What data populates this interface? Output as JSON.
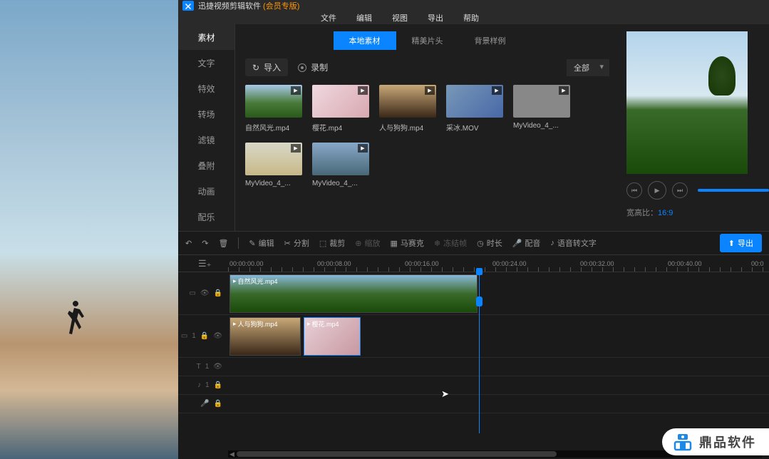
{
  "titlebar": {
    "app_name": "迅捷视频剪辑软件",
    "suffix": " (会员专版)"
  },
  "menubar": [
    "文件",
    "编辑",
    "视图",
    "导出",
    "帮助"
  ],
  "sidebar": {
    "items": [
      "素材",
      "文字",
      "特效",
      "转场",
      "滤镜",
      "叠附",
      "动画",
      "配乐"
    ],
    "active_index": 0
  },
  "media_tabs": {
    "items": [
      "本地素材",
      "精美片头",
      "背景样例"
    ],
    "active_index": 0
  },
  "media_toolbar": {
    "import_label": "导入",
    "record_label": "录制",
    "dropdown_label": "全部"
  },
  "media_items": [
    {
      "name": "自然风光.mp4",
      "thumb_class": "th-nature"
    },
    {
      "name": "樱花.mp4",
      "thumb_class": "th-sakura"
    },
    {
      "name": "人与狗狗.mp4",
      "thumb_class": "th-person"
    },
    {
      "name": "采冰.MOV",
      "thumb_class": "th-ice"
    },
    {
      "name": "MyVideo_4_...",
      "thumb_class": "th-gen"
    },
    {
      "name": "MyVideo_4_...",
      "thumb_class": "th-field"
    },
    {
      "name": "MyVideo_4_...",
      "thumb_class": "th-road"
    }
  ],
  "preview": {
    "aspect_label": "宽高比：",
    "aspect_value": "16:9"
  },
  "toolbar": {
    "edit": "编辑",
    "split": "分割",
    "crop": "裁剪",
    "zoom": "缩放",
    "mosaic": "马赛克",
    "freeze": "冻结帧",
    "duration": "时长",
    "voice": "配音",
    "stt": "语音转文字",
    "export": "导出"
  },
  "ruler_marks": [
    "00:00:00.00",
    "00:00:08.00",
    "00:00:16.00",
    "00:00:24.00",
    "00:00:32.00",
    "00:00:40.00",
    "00:0"
  ],
  "clips": {
    "track1": {
      "name": "自然风光.mp4"
    },
    "track2_a": {
      "name": "人与狗狗.mp4"
    },
    "track2_b": {
      "name": "樱花.mp4"
    }
  },
  "watermark": {
    "text": "鼎品软件"
  }
}
